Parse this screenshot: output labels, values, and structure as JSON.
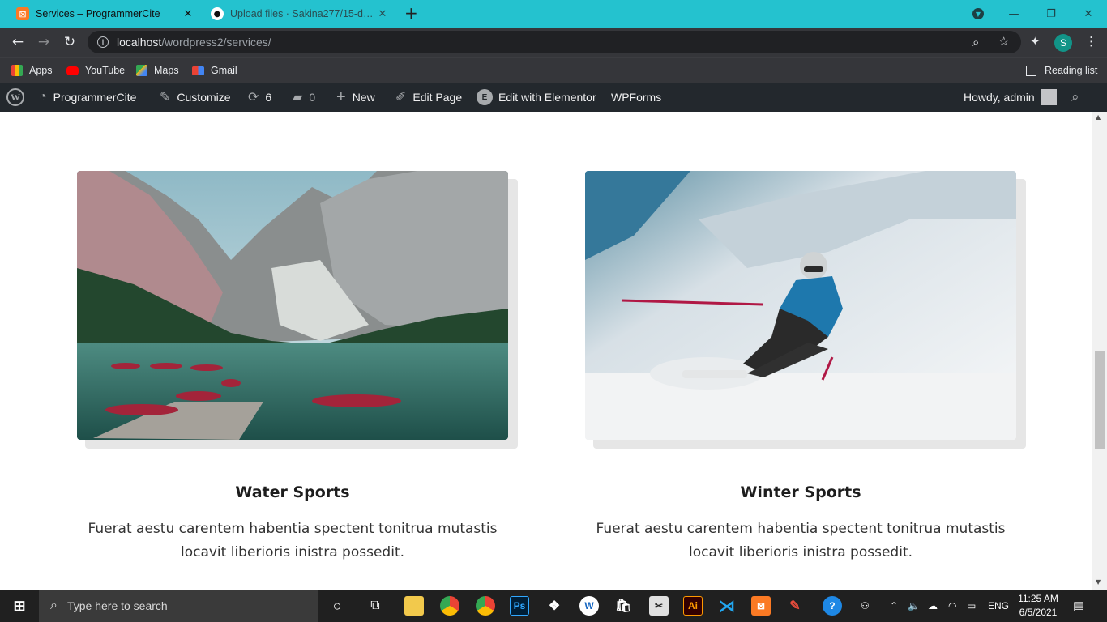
{
  "browser": {
    "tabs": [
      {
        "title": "Services – ProgrammerCite",
        "active": true
      },
      {
        "title": "Upload files · Sakina277/15-days",
        "active": false
      }
    ],
    "new_tab_label": "+",
    "window_controls": {
      "minimize": "—",
      "restore": "❐",
      "close": "✕"
    },
    "url_host": "localhost",
    "url_path": "/wordpress2/services/",
    "profile_initial": "S",
    "bookmarks": [
      "Apps",
      "YouTube",
      "Maps",
      "Gmail"
    ],
    "reading_list": "Reading list"
  },
  "wp_admin_bar": {
    "site_name": "ProgrammerCite",
    "customize": "Customize",
    "updates_count": "6",
    "comments_count": "0",
    "new": "New",
    "edit_page": "Edit Page",
    "edit_elementor": "Edit with Elementor",
    "wpforms": "WPForms",
    "howdy": "Howdy, admin"
  },
  "services": [
    {
      "title": "Water Sports",
      "description_line1": "Fuerat aestu carentem habentia spectent tonitrua mutastis",
      "description_line2": "locavit liberioris inistra possedit.",
      "image": "mountain-lake-boats"
    },
    {
      "title": "Winter Sports",
      "description_line1": "Fuerat aestu carentem habentia spectent tonitrua mutastis",
      "description_line2": "locavit liberioris inistra possedit.",
      "image": "skier-snow"
    }
  ],
  "taskbar": {
    "search_placeholder": "Type here to search",
    "language": "ENG",
    "time": "11:25 AM",
    "date": "6/5/2021"
  },
  "colors": {
    "tab_strip": "#24c2cf",
    "toolbar": "#35363a",
    "wp_admin_bar": "#23282d",
    "taskbar": "#202020"
  }
}
